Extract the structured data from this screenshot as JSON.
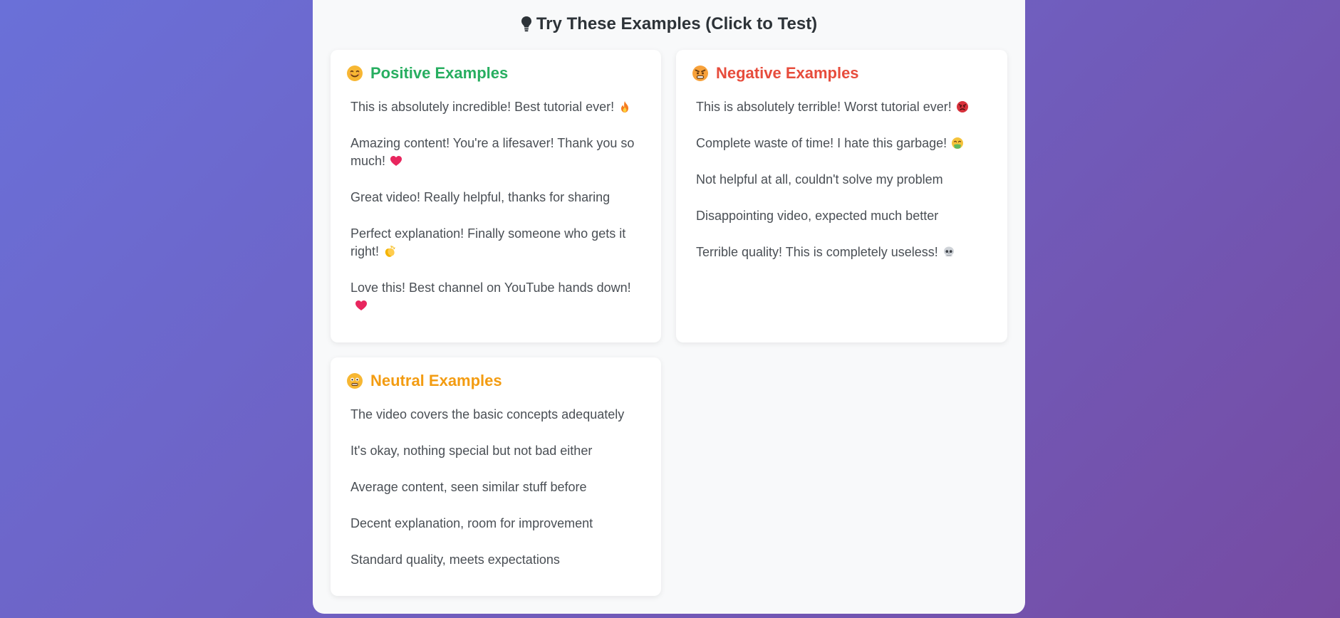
{
  "section": {
    "title": "Try These Examples (Click to Test)",
    "icon": "lightbulb-icon"
  },
  "positive": {
    "title": "Positive Examples",
    "icon": "smiling-face-icon",
    "color": "#27ae60",
    "items": [
      {
        "text": "This is absolutely incredible! Best tutorial ever!",
        "icon": "fire-icon"
      },
      {
        "text": "Amazing content! You're a lifesaver! Thank you so much!",
        "icon": "heart-icon"
      },
      {
        "text": "Great video! Really helpful, thanks for sharing",
        "icon": ""
      },
      {
        "text": "Perfect explanation! Finally someone who gets it right!",
        "icon": "clapping-hands-icon"
      },
      {
        "text": "Love this! Best channel on YouTube hands down!",
        "icon": "heart-icon"
      }
    ]
  },
  "negative": {
    "title": "Negative Examples",
    "icon": "angry-face-icon",
    "color": "#e74c3c",
    "items": [
      {
        "text": "This is absolutely terrible! Worst tutorial ever!",
        "icon": "enraged-face-icon"
      },
      {
        "text": "Complete waste of time! I hate this garbage!",
        "icon": "nauseated-face-icon"
      },
      {
        "text": "Not helpful at all, couldn't solve my problem",
        "icon": ""
      },
      {
        "text": "Disappointing video, expected much better",
        "icon": ""
      },
      {
        "text": "Terrible quality! This is completely useless!",
        "icon": "skull-icon"
      }
    ]
  },
  "neutral": {
    "title": "Neutral Examples",
    "icon": "neutral-face-icon",
    "color": "#f39c12",
    "items": [
      {
        "text": "The video covers the basic concepts adequately",
        "icon": ""
      },
      {
        "text": "It's okay, nothing special but not bad either",
        "icon": ""
      },
      {
        "text": "Average content, seen similar stuff before",
        "icon": ""
      },
      {
        "text": "Decent explanation, room for improvement",
        "icon": ""
      },
      {
        "text": "Standard quality, meets expectations",
        "icon": ""
      }
    ]
  }
}
